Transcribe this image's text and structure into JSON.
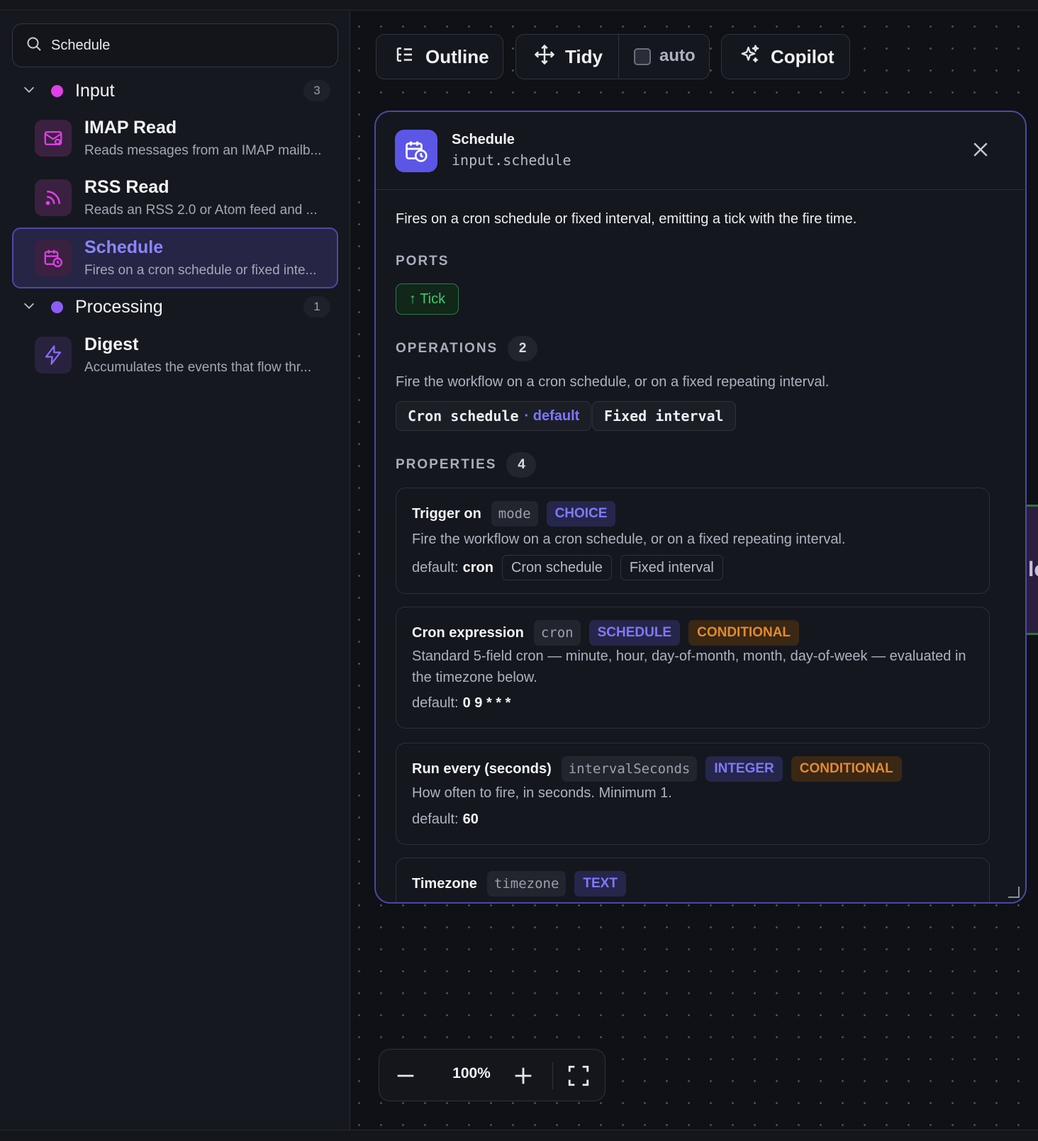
{
  "search": {
    "value": "Schedule"
  },
  "sidebar": {
    "groups": [
      {
        "label": "Input",
        "count": "3",
        "color": "#e040e8"
      },
      {
        "label": "Processing",
        "count": "1",
        "color": "#8b5cf6"
      }
    ],
    "items": [
      {
        "title": "IMAP Read",
        "description": "Reads messages from an IMAP mailb...",
        "icon": "mail-icon"
      },
      {
        "title": "RSS Read",
        "description": "Reads an RSS 2.0 or Atom feed and ...",
        "icon": "rss-icon"
      },
      {
        "title": "Schedule",
        "description": "Fires on a cron schedule or fixed inte...",
        "icon": "calendar-clock-icon"
      },
      {
        "title": "Digest",
        "description": "Accumulates the events that flow thr...",
        "icon": "lightning-icon"
      }
    ]
  },
  "toolbar": {
    "outline_label": "Outline",
    "tidy_label": "Tidy",
    "auto_label": "auto",
    "copilot_label": "Copilot"
  },
  "peek_node": {
    "text": "le"
  },
  "panel": {
    "title": "Schedule",
    "id": "input.schedule",
    "description": "Fires on a cron schedule or fixed interval, emitting a tick with the fire time.",
    "ports_heading": "PORTS",
    "ports": [
      "↑ Tick"
    ],
    "operations_heading": "OPERATIONS",
    "operations_count": "2",
    "operations_description": "Fire the workflow on a cron schedule, or on a fixed repeating interval.",
    "operations": [
      {
        "name": "Cron schedule",
        "default_tag": "· default"
      },
      {
        "name": "Fixed interval"
      }
    ],
    "properties_heading": "PROPERTIES",
    "properties_count": "4",
    "properties": [
      {
        "name": "Trigger on",
        "key": "mode",
        "type": "CHOICE",
        "description": "Fire the workflow on a cron schedule, or on a fixed repeating interval.",
        "default_label": "default:",
        "default_value": "cron",
        "options": [
          "Cron schedule",
          "Fixed interval"
        ]
      },
      {
        "name": "Cron expression",
        "key": "cron",
        "type": "SCHEDULE",
        "conditional": "CONDITIONAL",
        "description": "Standard 5-field cron — minute, hour, day-of-month, month, day-of-week — evaluated in the timezone below.",
        "default_label": "default:",
        "default_value": "0 9 * * *"
      },
      {
        "name": "Run every (seconds)",
        "key": "intervalSeconds",
        "type": "INTEGER",
        "conditional": "CONDITIONAL",
        "description": "How often to fire, in seconds. Minimum 1.",
        "default_label": "default:",
        "default_value": "60"
      },
      {
        "name": "Timezone",
        "key": "timezone",
        "type": "TEXT"
      }
    ]
  },
  "zoom": {
    "level": "100%"
  },
  "colors": {
    "accent": "#7d77ff",
    "success": "#42c86f",
    "warning": "#e28a2e",
    "panel_border": "#4b49a3"
  }
}
